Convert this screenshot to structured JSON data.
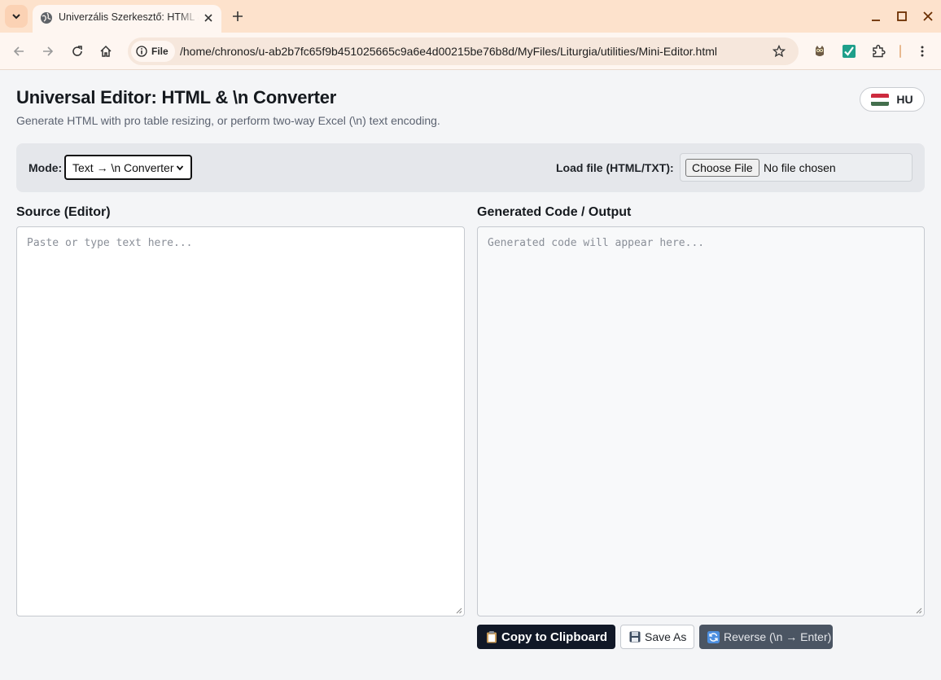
{
  "browser": {
    "tab_title": "Univerzális Szerkesztő: HTML & \\n Converter",
    "site_chip": "File",
    "url": "/home/chronos/u-ab2b7fc65f9b451025665c9a6e4d00215be76b8d/MyFiles/Liturgia/utilities/Mini-Editor.html"
  },
  "header": {
    "title": "Universal Editor: HTML & \\n Converter",
    "subtitle": "Generate HTML with pro table resizing, or perform two-way Excel (\\n) text encoding.",
    "lang_label": "HU",
    "flag_colors": [
      "#cd2a3e",
      "#ffffff",
      "#436f4d"
    ]
  },
  "controls": {
    "mode_label": "Mode:",
    "mode_value": "Text → \\n Converter",
    "load_label": "Load file (HTML/TXT):",
    "file_button": "Choose File",
    "file_status": "No file chosen"
  },
  "source": {
    "label": "Source (Editor)",
    "placeholder": "Paste or type text here..."
  },
  "output": {
    "label": "Generated Code / Output",
    "placeholder": "Generated code will appear here..."
  },
  "actions": {
    "copy": "Copy to Clipboard",
    "copy_icon": "clipboard-icon",
    "save": "Save As",
    "save_icon": "floppy-disk-icon",
    "reverse": "Reverse (\\n → Enter)",
    "reverse_icon": "arrows-cycle-icon"
  },
  "colors": {
    "tabbar": "#fde2cc",
    "copy_button": "#111827",
    "reverse_button": "#4b5563"
  }
}
